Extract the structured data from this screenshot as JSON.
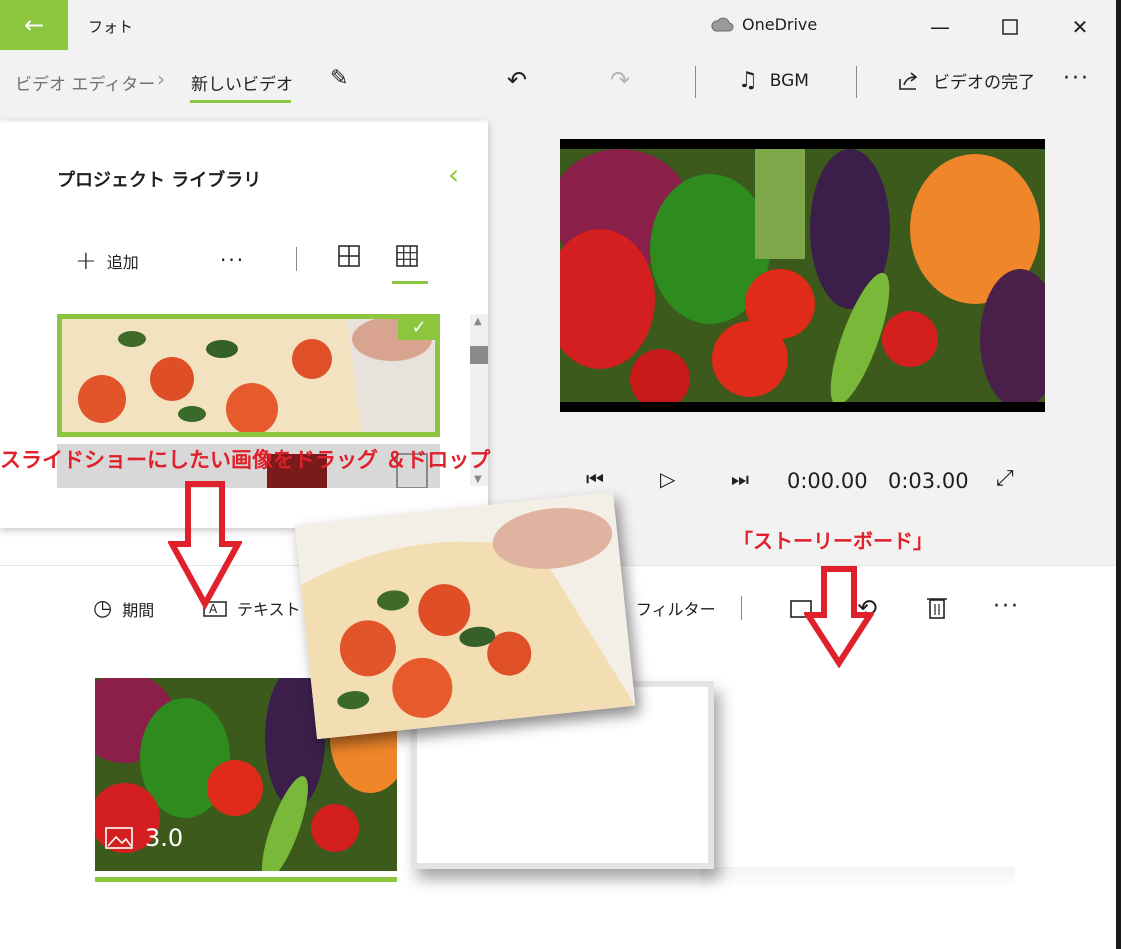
{
  "titlebar": {
    "app_title": "フォト",
    "cloud_label": "OneDrive"
  },
  "breadcrumb": {
    "root": "ビデオ エディター",
    "current": "新しいビデオ"
  },
  "toolbar": {
    "bgm_label": "BGM",
    "finish_label": "ビデオの完了"
  },
  "library": {
    "title": "プロジェクト ライブラリ",
    "add_label": "追加"
  },
  "playback": {
    "current_time": "0:00.00",
    "total_time": "0:03.00"
  },
  "storyboard_toolbar": {
    "duration_label": "期間",
    "text_label": "テキスト",
    "filter_label": "フィルター"
  },
  "storyboard": {
    "tiles": [
      {
        "duration": "3.0"
      }
    ]
  },
  "annotations": {
    "drag_instruction": "スライドショーにしたい画像をドラッグ ＆ドロップ",
    "storyboard_callout": "「ストーリーボード」"
  },
  "colors": {
    "accent": "#8cc63f",
    "annotation": "#e0202a"
  }
}
